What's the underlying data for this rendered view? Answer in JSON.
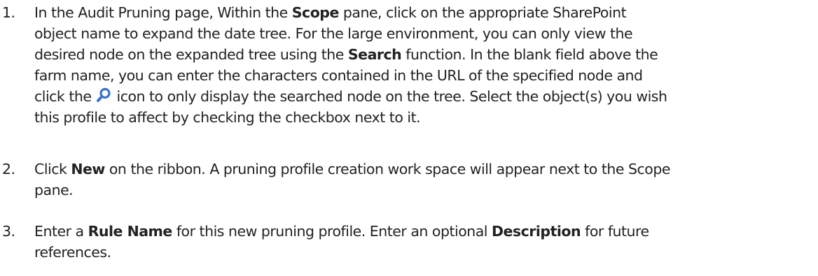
{
  "steps": [
    {
      "number": "1.",
      "line1_a": "In the Audit Pruning page, Within the ",
      "line1_b": "Scope",
      "line1_c": " pane, click on the appropriate SharePoint",
      "line2": "object name to   expand the date tree. For the large environment, you can only view the",
      "line3_a": "desired node on the expanded tree using the ",
      "line3_b": "Search",
      "line3_c": " function. In the blank field above the",
      "line4": "farm name, you can enter the characters contained in the URL of the specified node and",
      "line5_a": "click the ",
      "line5_icon": "search-icon",
      "line5_b": " icon to only display the searched node on the tree. Select the object(s) you wish",
      "line6": "this profile to affect by checking the checkbox next to it."
    },
    {
      "number": "2.",
      "line1_a": "Click ",
      "line1_b": "New",
      "line1_c": " on the ribbon. A pruning profile creation work space will appear next to the Scope",
      "line2": "pane."
    },
    {
      "number": "3.",
      "line1_a": "Enter a ",
      "line1_b": "Rule Name",
      "line1_c": " for this new pruning profile. Enter an optional ",
      "line1_d": "Description",
      "line1_e": " for future",
      "line2": "references."
    }
  ],
  "colors": {
    "text": "#222222",
    "icon": "#3a73c8"
  }
}
